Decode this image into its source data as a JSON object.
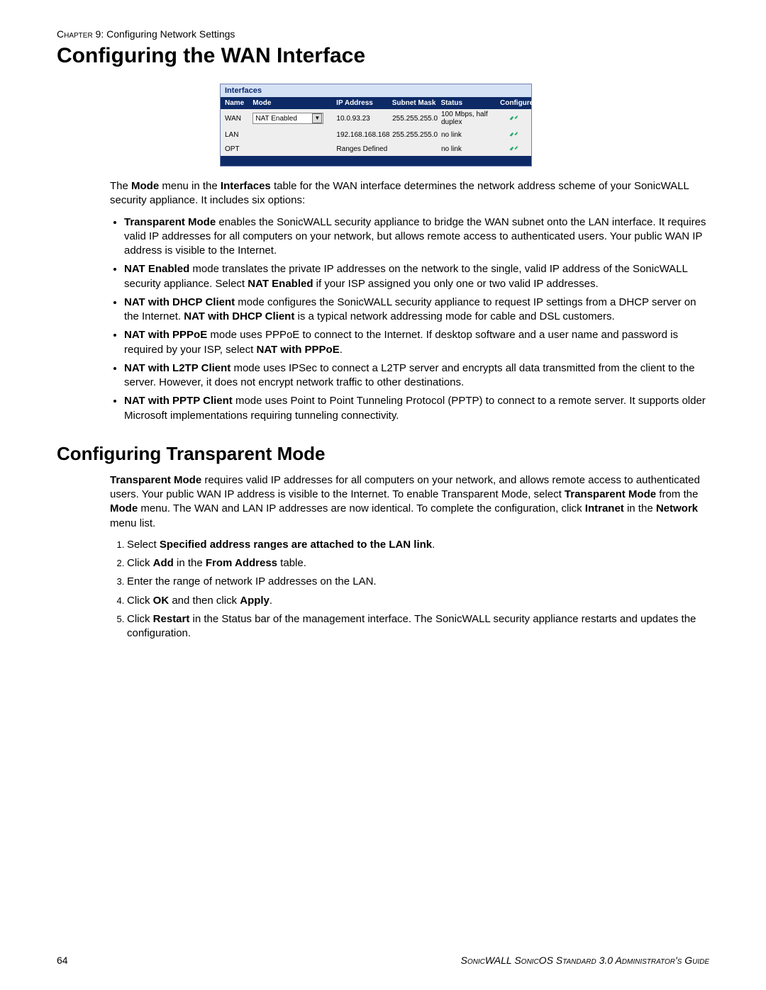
{
  "header": {
    "chapter_label": "Chapter",
    "chapter_text": " 9: Configuring Network Settings"
  },
  "heading1": "Configuring the WAN Interface",
  "interfaces": {
    "title": "Interfaces",
    "columns": {
      "name": "Name",
      "mode": "Mode",
      "ip": "IP Address",
      "mask": "Subnet Mask",
      "status": "Status",
      "configure": "Configure"
    },
    "rows": [
      {
        "name": "WAN",
        "mode": "NAT Enabled",
        "ip": "10.0.93.23",
        "mask": "255.255.255.0",
        "status": "100 Mbps, half duplex"
      },
      {
        "name": "LAN",
        "mode": "",
        "ip": "192.168.168.168",
        "mask": "255.255.255.0",
        "status": "no link"
      },
      {
        "name": "OPT",
        "mode": "",
        "ip": "Ranges Defined",
        "mask": "",
        "status": "no link"
      }
    ]
  },
  "intro": {
    "pre": "The ",
    "b1": "Mode",
    "mid1": " menu in the ",
    "b2": "Interfaces",
    "post": " table for the WAN interface determines the network address scheme of your SonicWALL security appliance. It includes six options:"
  },
  "bullets": [
    {
      "b": "Transparent Mode",
      "t": " enables the SonicWALL security appliance to bridge the WAN subnet onto the LAN interface. It requires valid IP addresses for all computers on your network, but allows remote access to authenticated users. Your public WAN IP address is visible to the Internet."
    },
    {
      "b": "NAT Enabled",
      "mid": " mode translates the private IP addresses on the network to the single, valid IP address of the SonicWALL security appliance. Select ",
      "b2": "NAT Enabled",
      "t": " if your ISP assigned you only one or two valid IP addresses."
    },
    {
      "b": "NAT with DHCP Client",
      "mid": " mode configures the SonicWALL security appliance to request IP settings from a DHCP server on the Internet. ",
      "b2": "NAT with DHCP Client",
      "t": " is a typical network addressing mode for cable and DSL customers."
    },
    {
      "b": "NAT with PPPoE",
      "mid": " mode uses PPPoE to connect to the Internet. If desktop software and a user name and password is required by your ISP, select ",
      "b2": "NAT with PPPoE",
      "t": "."
    },
    {
      "b": "NAT with L2TP Client",
      "t": " mode uses IPSec to connect a L2TP server and encrypts all data transmitted from the client to the server. However, it does not encrypt network traffic to other destinations."
    },
    {
      "b": "NAT with PPTP Client",
      "t": " mode uses Point to Point Tunneling Protocol (PPTP) to connect to a remote server. It supports older Microsoft implementations requiring tunneling connectivity."
    }
  ],
  "heading2": "Configuring Transparent Mode",
  "tm_para": {
    "b1": "Transparent Mode",
    "t1": " requires valid IP addresses for all computers on your network, and allows remote access to authenticated users. Your public WAN IP address is visible to the Internet. To enable Transparent Mode, select ",
    "b2": "Transparent Mode",
    "t2": " from the ",
    "b3": "Mode",
    "t3": " menu. The WAN and LAN IP addresses are now identical. To complete the configuration, click ",
    "b4": "Intranet",
    "t4": " in the ",
    "b5": "Network",
    "t5": " menu list."
  },
  "steps": {
    "s1_pre": "Select ",
    "s1_b": "Specified address ranges are attached to the LAN link",
    "s1_post": ".",
    "s2_pre": "Click ",
    "s2_b1": "Add",
    "s2_mid": " in the ",
    "s2_b2": "From Address",
    "s2_post": " table.",
    "s3": "Enter the range of network IP addresses on the LAN.",
    "s4_pre": "Click ",
    "s4_b1": "OK",
    "s4_mid": " and then click ",
    "s4_b2": "Apply",
    "s4_post": ".",
    "s5_pre": "Click ",
    "s5_b": "Restart",
    "s5_post": " in the Status bar of the management interface. The SonicWALL security appliance restarts and updates the configuration."
  },
  "footer": {
    "page_no": "64",
    "guide": "SonicWALL SonicOS Standard 3.0 Administrator's Guide"
  }
}
